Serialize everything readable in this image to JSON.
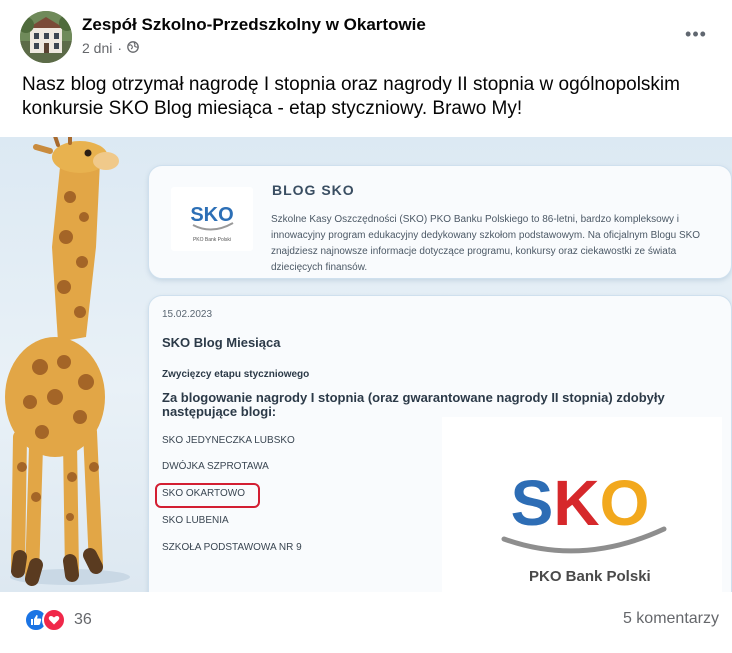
{
  "post": {
    "page_name": "Zespół Szkolno-Przedszkolny w Okartowie",
    "time": "2 dni",
    "privacy_icon": "globe-icon",
    "more_icon": "more-dots-icon",
    "text": "Nasz blog otrzymał nagrodę I stopnia oraz nagrody II stopnia w ogólnopolskim konkursie SKO Blog miesiąca - etap styczniowy. Brawo My!"
  },
  "image": {
    "blog_title": "BLOG SKO",
    "blog_description": "Szkolne Kasy Oszczędności (SKO) PKO Banku Polskiego to 86-letni, bardzo kompleksowy i innowacyjny program edukacyjny dedykowany szkołom podstawowym. Na oficjalnym Blogu SKO znajdziesz najnowsze informacje dotyczące programu, konkursy oraz ciekawostki ze świata dziecięcych finansów.",
    "small_logo_text": "SKO",
    "small_logo_sub": "PKO Bank Polski",
    "date": "15.02.2023",
    "article_title": "SKO Blog Miesiąca",
    "winners_heading": "Zwycięzcy etapu styczniowego",
    "award_text": "Za blogowanie nagrody I stopnia (oraz gwarantowane nagrody II stopnia) zdobyły następujące blogi:",
    "blogs": [
      "SKO JEDYNECZKA LUBSKO",
      "DWÓJKA SZPROTAWA",
      "SKO OKARTOWO",
      "SKO LUBENIA",
      "SZKOŁA PODSTAWOWA NR 9"
    ],
    "big_logo_text": "SKO",
    "big_logo_sub": "PKO Bank Polski",
    "highlight_color": "#d31e32"
  },
  "footer": {
    "reaction_icons": [
      "like-icon",
      "love-icon"
    ],
    "reaction_count": "36",
    "comments": "5 komentarzy"
  }
}
